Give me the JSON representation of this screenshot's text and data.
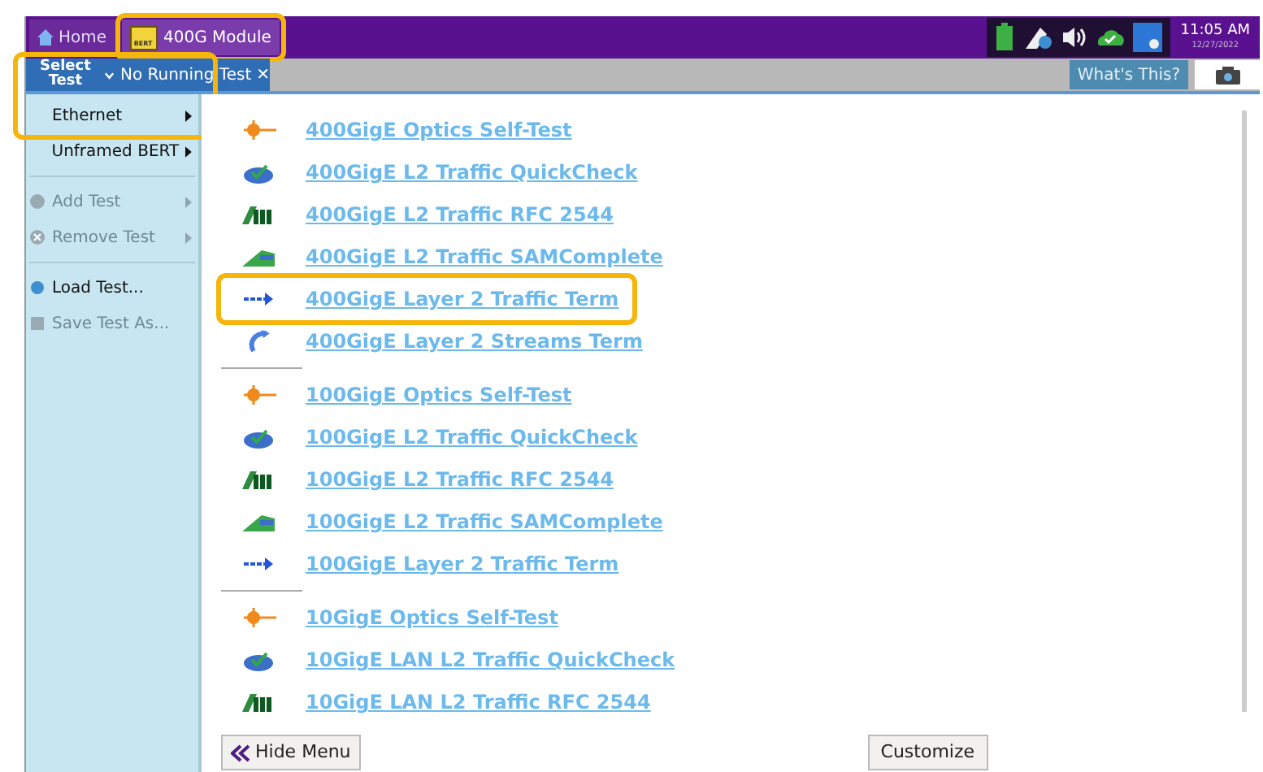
{
  "top_bar": {
    "home": "Home",
    "module": {
      "label": "400G Module",
      "badge": "BERT",
      "highlighted": true
    },
    "time": "11:05 AM",
    "date": "12/27/2022"
  },
  "tab_bar": {
    "select_test": "Select Test",
    "running_tab": "No Running Test",
    "close": "✕",
    "help": "What's This?"
  },
  "menu": {
    "highlighted": true,
    "items": [
      {
        "kind": "item",
        "label": "Ethernet",
        "disabled": false,
        "submenu": true
      },
      {
        "kind": "item",
        "label": "Unframed BERT",
        "disabled": false,
        "submenu": true
      },
      {
        "kind": "divider"
      },
      {
        "kind": "item",
        "label": "Add Test",
        "disabled": true,
        "submenu": true
      },
      {
        "kind": "item",
        "label": "Remove Test",
        "disabled": true,
        "submenu": true
      },
      {
        "kind": "divider"
      },
      {
        "kind": "item",
        "label": "Load Test...",
        "disabled": false,
        "submenu": false
      },
      {
        "kind": "item",
        "label": "Save Test As...",
        "disabled": true,
        "submenu": false
      }
    ]
  },
  "tests": [
    [
      {
        "kind": "optics",
        "label": "400GigE Optics Self-Test",
        "highlighted": false
      },
      {
        "kind": "quickcheck",
        "label": "400GigE L2 Traffic QuickCheck",
        "highlighted": false
      },
      {
        "kind": "rfc",
        "label": "400GigE L2 Traffic RFC 2544",
        "highlighted": false
      },
      {
        "kind": "sam",
        "label": "400GigE L2 Traffic SAMComplete",
        "highlighted": false
      },
      {
        "kind": "term",
        "label": "400GigE Layer 2 Traffic Term",
        "highlighted": true
      },
      {
        "kind": "streams",
        "label": "400GigE Layer 2 Streams Term",
        "highlighted": false
      }
    ],
    [
      {
        "kind": "optics",
        "label": "100GigE Optics Self-Test",
        "highlighted": false
      },
      {
        "kind": "quickcheck",
        "label": "100GigE L2 Traffic QuickCheck",
        "highlighted": false
      },
      {
        "kind": "rfc",
        "label": "100GigE L2 Traffic RFC 2544",
        "highlighted": false
      },
      {
        "kind": "sam",
        "label": "100GigE L2 Traffic SAMComplete",
        "highlighted": false
      },
      {
        "kind": "term",
        "label": "100GigE Layer 2 Traffic Term",
        "highlighted": false
      }
    ],
    [
      {
        "kind": "optics",
        "label": "10GigE Optics Self-Test",
        "highlighted": false
      },
      {
        "kind": "quickcheck",
        "label": "10GigE LAN L2 Traffic QuickCheck",
        "highlighted": false
      },
      {
        "kind": "rfc",
        "label": "10GigE LAN L2 Traffic RFC 2544",
        "highlighted": false
      }
    ]
  ],
  "buttons": {
    "hide_menu": "Hide Menu",
    "customize": "Customize"
  }
}
